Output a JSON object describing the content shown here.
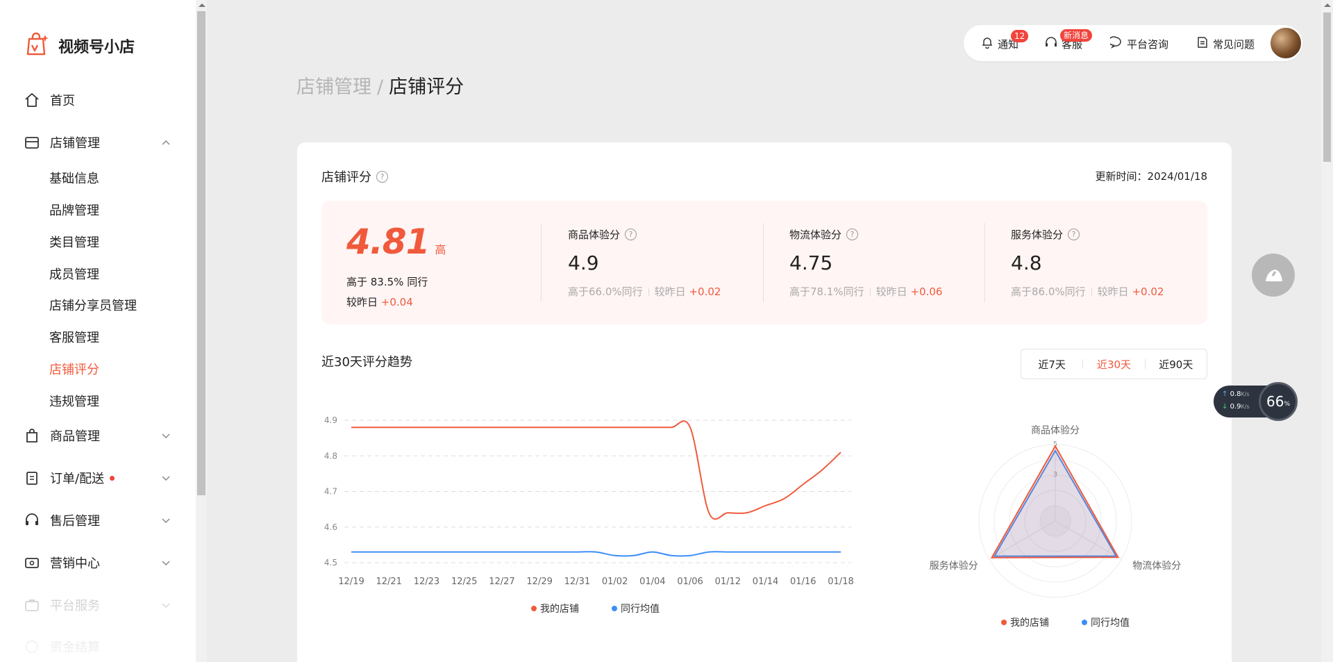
{
  "app": {
    "name": "视频号小店"
  },
  "sidebar": {
    "items": [
      {
        "label": "首页"
      },
      {
        "label": "店铺管理"
      },
      {
        "label": "商品管理"
      },
      {
        "label": "订单/配送"
      },
      {
        "label": "售后管理"
      },
      {
        "label": "营销中心"
      },
      {
        "label": "平台服务"
      },
      {
        "label": "资金结算"
      }
    ],
    "sub_items": [
      "基础信息",
      "品牌管理",
      "类目管理",
      "成员管理",
      "店铺分享员管理",
      "客服管理",
      "店铺评分",
      "违规管理"
    ]
  },
  "topbar": {
    "notify_label": "通知",
    "notify_badge": "12",
    "service_label": "客服",
    "service_badge": "新消息",
    "consult_label": "平台咨询",
    "faq_label": "常见问题"
  },
  "breadcrumb": {
    "parent": "店铺管理",
    "separator": "/",
    "current": "店铺评分"
  },
  "card": {
    "title": "店铺评分",
    "update_time": "更新时间：2024/01/18",
    "total": {
      "value": "4.81",
      "level": "高",
      "higher_than": "高于 83.5% 同行",
      "vs_yesterday_label": "较昨日",
      "vs_yesterday_value": "+0.04"
    },
    "sub_scores": [
      {
        "name": "商品体验分",
        "value": "4.9",
        "higher": "高于66.0%同行",
        "vs_label": "较昨日",
        "vs_value": "+0.02"
      },
      {
        "name": "物流体验分",
        "value": "4.75",
        "higher": "高于78.1%同行",
        "vs_label": "较昨日",
        "vs_value": "+0.06"
      },
      {
        "name": "服务体验分",
        "value": "4.8",
        "higher": "高于86.0%同行",
        "vs_label": "较昨日",
        "vs_value": "+0.02"
      }
    ],
    "trend_title": "近30天评分趋势",
    "range_tabs": [
      "近7天",
      "近30天",
      "近90天"
    ],
    "active_range": "近30天"
  },
  "widgets": {
    "net_up": "0.8",
    "net_down": "0.9",
    "net_unit": "K/s",
    "cpu": "66",
    "cpu_unit": "%"
  },
  "colors": {
    "accent": "#f05a3c",
    "peer": "#3d8ef8",
    "panel_bg": "#fff5f4"
  },
  "chart_data": [
    {
      "type": "line",
      "x": [
        "12/19",
        "12/20",
        "12/21",
        "12/22",
        "12/23",
        "12/24",
        "12/25",
        "12/26",
        "12/27",
        "12/28",
        "12/29",
        "12/30",
        "12/31",
        "01/01",
        "01/02",
        "01/03",
        "01/04",
        "01/05",
        "01/06",
        "01/07",
        "01/12",
        "01/13",
        "01/14",
        "01/15",
        "01/16",
        "01/17",
        "01/18"
      ],
      "x_tick_labels": [
        "12/19",
        "12/21",
        "12/23",
        "12/25",
        "12/27",
        "12/29",
        "12/31",
        "01/02",
        "01/04",
        "01/06",
        "01/12",
        "01/14",
        "01/16",
        "01/18"
      ],
      "series": [
        {
          "name": "我的店铺",
          "color": "#f05a3c",
          "values": [
            4.88,
            4.88,
            4.88,
            4.88,
            4.88,
            4.88,
            4.88,
            4.88,
            4.88,
            4.88,
            4.88,
            4.88,
            4.88,
            4.88,
            4.88,
            4.88,
            4.88,
            4.88,
            4.88,
            4.64,
            4.64,
            4.64,
            4.66,
            4.68,
            4.72,
            4.76,
            4.81
          ]
        },
        {
          "name": "同行均值",
          "color": "#3d8ef8",
          "values": [
            4.53,
            4.53,
            4.53,
            4.53,
            4.53,
            4.53,
            4.53,
            4.53,
            4.53,
            4.53,
            4.53,
            4.53,
            4.53,
            4.53,
            4.52,
            4.52,
            4.53,
            4.52,
            4.52,
            4.53,
            4.53,
            4.53,
            4.53,
            4.53,
            4.53,
            4.53,
            4.53
          ]
        }
      ],
      "ylim": [
        4.5,
        4.9
      ],
      "y_ticks": [
        "4.5",
        "4.6",
        "4.7",
        "4.8",
        "4.9"
      ],
      "grid": true,
      "legend": "bottom"
    },
    {
      "type": "radar",
      "axes": [
        "商品体验分",
        "物流体验分",
        "服务体验分"
      ],
      "series": [
        {
          "name": "我的店铺",
          "color": "#f05a3c",
          "values": [
            4.9,
            4.75,
            4.8
          ]
        },
        {
          "name": "同行均值",
          "color": "#3d8ef8",
          "values": [
            4.6,
            4.6,
            4.6
          ]
        }
      ],
      "rlim": [
        0,
        5
      ],
      "r_tick_labels": [
        "5",
        "3"
      ],
      "legend": "bottom"
    }
  ]
}
